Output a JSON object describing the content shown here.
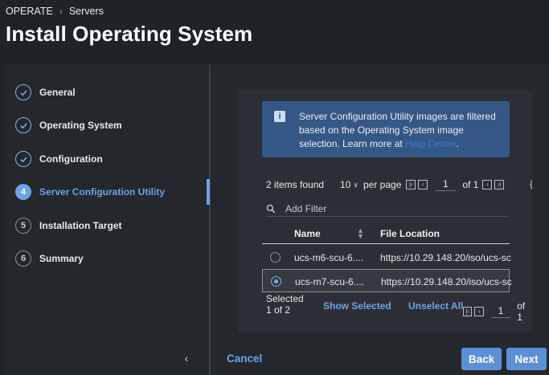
{
  "breadcrumb": {
    "section": "OPERATE",
    "page": "Servers"
  },
  "title": "Install Operating System",
  "steps": [
    {
      "number": "",
      "label": "General",
      "state": "done"
    },
    {
      "number": "",
      "label": "Operating System",
      "state": "done"
    },
    {
      "number": "",
      "label": "Configuration",
      "state": "done"
    },
    {
      "number": "4",
      "label": "Server Configuration Utility",
      "state": "active"
    },
    {
      "number": "5",
      "label": "Installation Target",
      "state": "pending"
    },
    {
      "number": "6",
      "label": "Summary",
      "state": "pending"
    }
  ],
  "info": {
    "text_before": "Server Configuration Utility images are filtered based on the Operating System image selection. Learn more at ",
    "link": "Help Center",
    "text_after": "."
  },
  "pager": {
    "items_found": "2 items found",
    "per_page_value": "10",
    "per_page_label": "per page",
    "page": "1",
    "of_pages": "of 1"
  },
  "filter": {
    "placeholder": "Add Filter"
  },
  "table": {
    "columns": {
      "name": "Name",
      "location": "File Location"
    },
    "rows": [
      {
        "name": "ucs-m6-scu-6....",
        "location": "https://10.29.148.20/iso/ucs-sc",
        "selected": false
      },
      {
        "name": "ucs-m7-scu-6....",
        "location": "https://10.29.148.20/iso/ucs-sc",
        "selected": true
      }
    ]
  },
  "selection": {
    "selected_label": "Selected",
    "count": "1 of 2",
    "show_selected": "Show Selected",
    "unselect_all": "Unselect All",
    "page": "1",
    "of_pages": "of 1"
  },
  "actions": {
    "cancel": "Cancel",
    "back": "Back",
    "next": "Next"
  },
  "colors": {
    "accent": "#6ea2e6",
    "info_bg": "#355786",
    "button_bg": "#5b8fd6"
  }
}
